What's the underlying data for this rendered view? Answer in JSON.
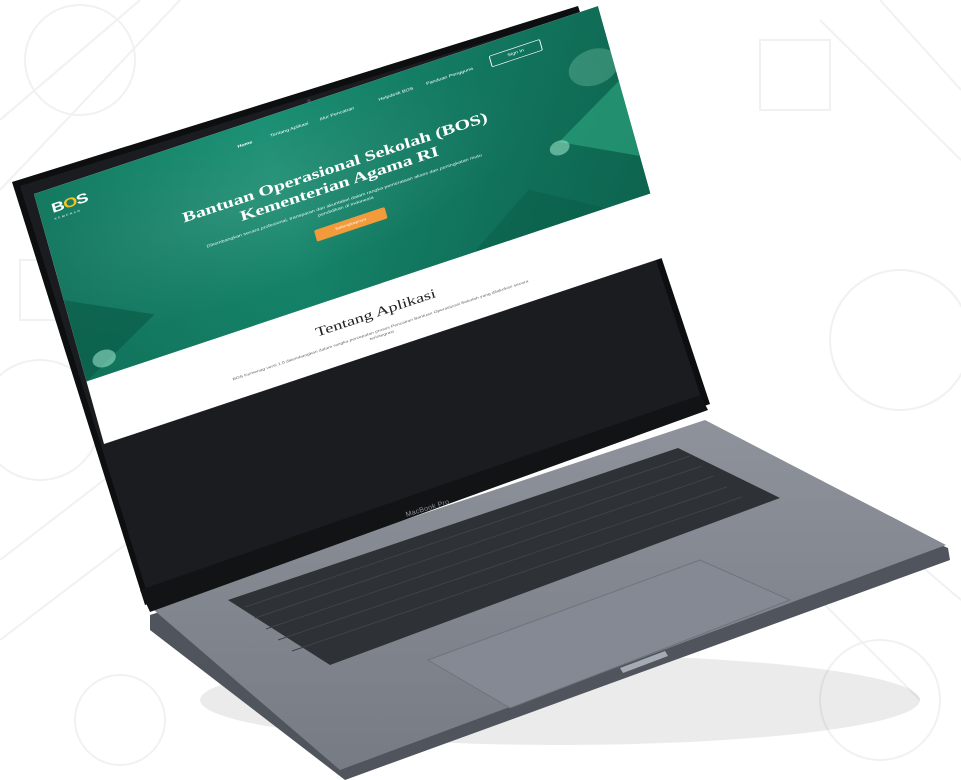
{
  "brand": {
    "logo_b": "B",
    "logo_o": "O",
    "logo_s": "S",
    "logo_sub": "KEMENAG"
  },
  "nav": {
    "items": [
      "Home",
      "Tentang Aplikasi",
      "Alur Pencairan",
      "Helpdesk BOS",
      "Panduan Pengguna"
    ],
    "signin_label": "Sign In"
  },
  "hero": {
    "title_line1": "Bantuan Operasional Sekolah (BOS)",
    "title_line2": "Kementerian Agama RI",
    "description": "Dikembangkan secara profesional, transparan dan akuntabel dalam rangka pemerataan akses dan peningkatan mutu pendidikan di Indonesia",
    "cta_label": "Selengkapnya"
  },
  "about": {
    "title": "Tentang Aplikasi",
    "description": "BOS Kemenag versi 1.0 dikembangkan dalam rangka percepatan proses Pencairan Bantuan Operasional Sekolah yang dilakukan secara terintegrasi"
  },
  "laptop": {
    "model_label": "MacBook Pro"
  },
  "colors": {
    "hero_green": "#1a9b7c",
    "accent_orange": "#f39a3b",
    "logo_yellow": "#f3c324",
    "laptop_gray": "#7b7f88"
  }
}
